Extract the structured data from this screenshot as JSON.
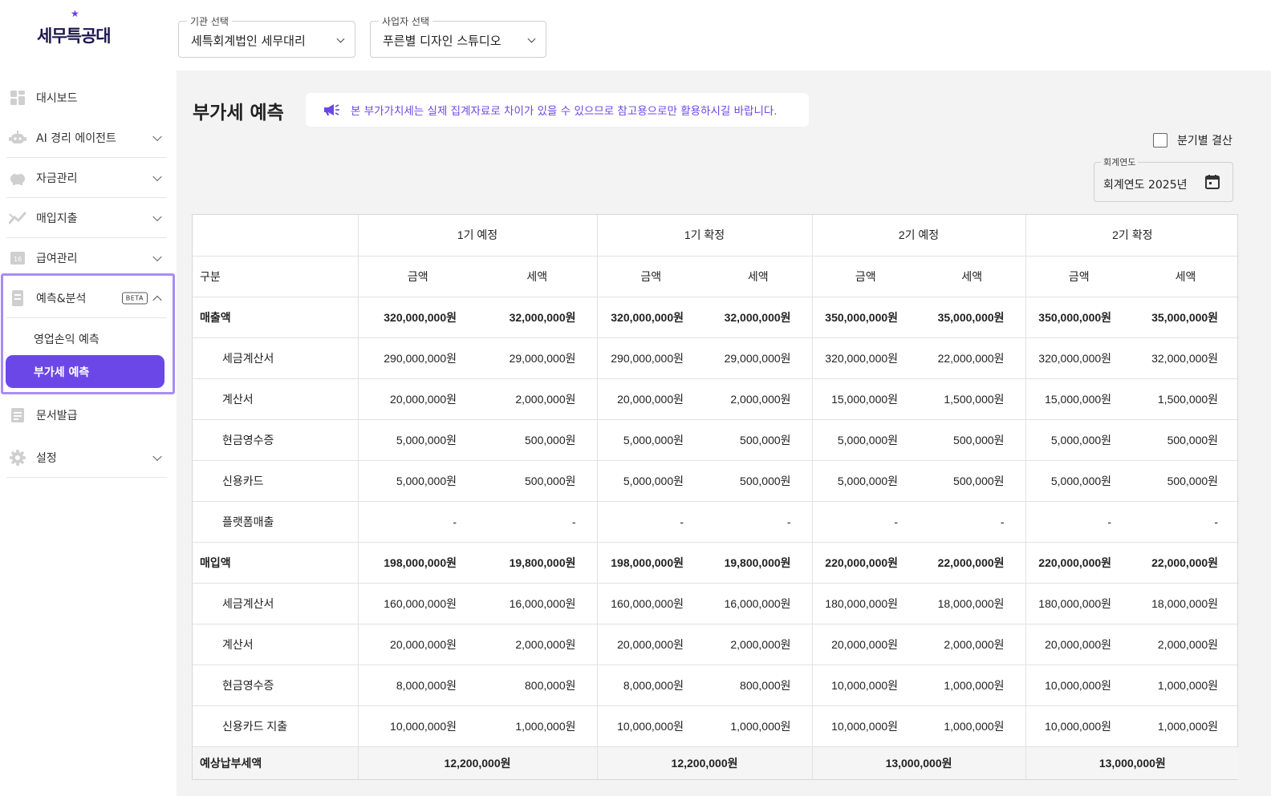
{
  "app": {
    "logo_text": "세무특공대"
  },
  "sidebar": {
    "items": [
      {
        "label": "대시보드",
        "icon": "dashboard-icon",
        "expandable": false
      },
      {
        "label": "AI 경리 에이전트",
        "icon": "robot-icon",
        "expandable": true
      },
      {
        "label": "자금관리",
        "icon": "piggy-bank-icon",
        "expandable": true
      },
      {
        "label": "매입지출",
        "icon": "trend-icon",
        "expandable": true
      },
      {
        "label": "급여관리",
        "icon": "payroll-icon",
        "expandable": true
      },
      {
        "label": "예측&분석",
        "icon": "forecast-icon",
        "expandable": true,
        "badge": "BETA"
      },
      {
        "label": "문서발급",
        "icon": "document-icon",
        "expandable": false
      },
      {
        "label": "설정",
        "icon": "gear-icon",
        "expandable": true
      }
    ],
    "sub_items": [
      {
        "label": "영업손익 예측"
      },
      {
        "label": "부가세 예측",
        "active": true
      }
    ],
    "accent_color": "#6c47e8"
  },
  "topbar": {
    "agency_select": {
      "legend": "기관 선택",
      "value": "세특회계법인 세무대리"
    },
    "business_select": {
      "legend": "사업자 선택",
      "value": "푸른별 디자인 스튜디오"
    }
  },
  "main": {
    "title": "부가세 예측",
    "notice": "본 부가가치세는 실제 집계자료로 차이가 있을 수 있으므로 참고용으로만 활용하시길 바랍니다.",
    "quarterly_checkbox_label": "분기별 결산",
    "fiscal_year": {
      "legend": "회계연도",
      "value": "회계연도 2025년"
    }
  },
  "table": {
    "gubun_label": "구분",
    "periods": [
      "1기 예정",
      "1기 확정",
      "2기 예정",
      "2기 확정"
    ],
    "sub_headers": {
      "amount": "금액",
      "tax": "세액"
    },
    "rows": [
      {
        "label": "매출액",
        "bold": true,
        "cells": [
          "320,000,000원",
          "32,000,000원",
          "320,000,000원",
          "32,000,000원",
          "350,000,000원",
          "35,000,000원",
          "350,000,000원",
          "35,000,000원"
        ]
      },
      {
        "label": "세금계산서",
        "bold": false,
        "cells": [
          "290,000,000원",
          "29,000,000원",
          "290,000,000원",
          "29,000,000원",
          "320,000,000원",
          "22,000,000원",
          "320,000,000원",
          "32,000,000원"
        ]
      },
      {
        "label": "계산서",
        "bold": false,
        "cells": [
          "20,000,000원",
          "2,000,000원",
          "20,000,000원",
          "2,000,000원",
          "15,000,000원",
          "1,500,000원",
          "15,000,000원",
          "1,500,000원"
        ]
      },
      {
        "label": "현금영수증",
        "bold": false,
        "cells": [
          "5,000,000원",
          "500,000원",
          "5,000,000원",
          "500,000원",
          "5,000,000원",
          "500,000원",
          "5,000,000원",
          "500,000원"
        ]
      },
      {
        "label": "신용카드",
        "bold": false,
        "cells": [
          "5,000,000원",
          "500,000원",
          "5,000,000원",
          "500,000원",
          "5,000,000원",
          "500,000원",
          "5,000,000원",
          "500,000원"
        ]
      },
      {
        "label": "플랫폼매출",
        "bold": false,
        "cells": [
          "-",
          "-",
          "-",
          "-",
          "-",
          "-",
          "-",
          "-"
        ]
      },
      {
        "label": "매입액",
        "bold": true,
        "cells": [
          "198,000,000원",
          "19,800,000원",
          "198,000,000원",
          "19,800,000원",
          "220,000,000원",
          "22,000,000원",
          "220,000,000원",
          "22,000,000원"
        ]
      },
      {
        "label": "세금계산서",
        "bold": false,
        "cells": [
          "160,000,000원",
          "16,000,000원",
          "160,000,000원",
          "16,000,000원",
          "180,000,000원",
          "18,000,000원",
          "180,000,000원",
          "18,000,000원"
        ]
      },
      {
        "label": "계산서",
        "bold": false,
        "cells": [
          "20,000,000원",
          "2,000,000원",
          "20,000,000원",
          "2,000,000원",
          "20,000,000원",
          "2,000,000원",
          "20,000,000원",
          "2,000,000원"
        ]
      },
      {
        "label": "현금영수증",
        "bold": false,
        "cells": [
          "8,000,000원",
          "800,000원",
          "8,000,000원",
          "800,000원",
          "10,000,000원",
          "1,000,000원",
          "10,000,000원",
          "1,000,000원"
        ]
      },
      {
        "label": "신용카드 지출",
        "bold": false,
        "cells": [
          "10,000,000원",
          "1,000,000원",
          "10,000,000원",
          "1,000,000원",
          "10,000,000원",
          "1,000,000원",
          "10,000,000원",
          "1,000,000원"
        ]
      }
    ],
    "total": {
      "label": "예상납부세액",
      "cells": [
        "12,200,000원",
        "12,200,000원",
        "13,000,000원",
        "13,000,000원"
      ]
    }
  }
}
